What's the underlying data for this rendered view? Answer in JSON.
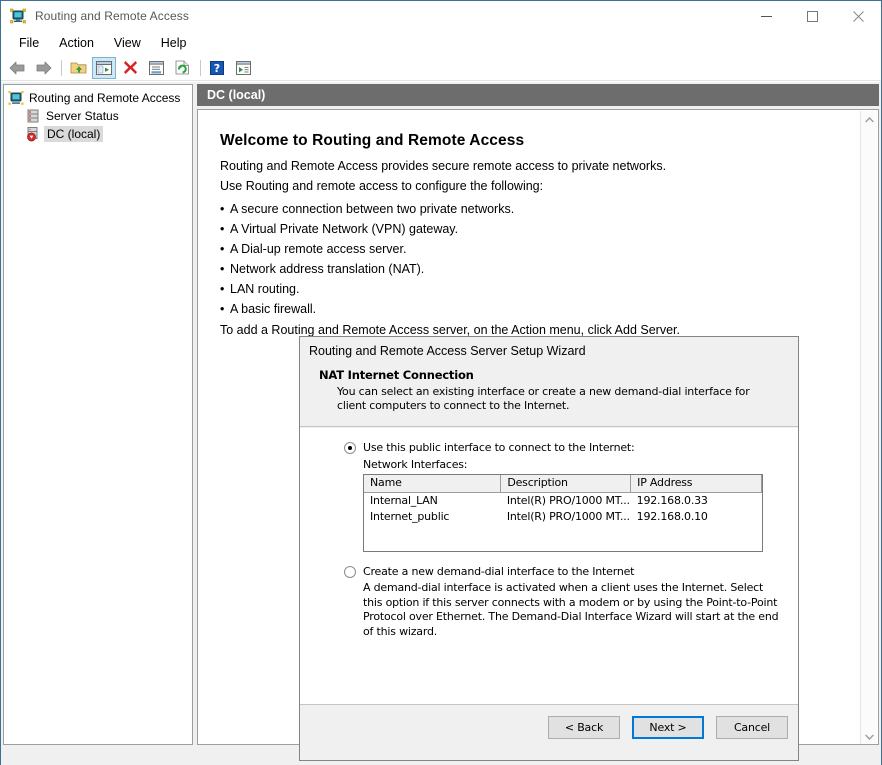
{
  "window": {
    "title": "Routing and Remote Access",
    "icon": "rras-console-icon",
    "controls": [
      {
        "name": "minimize-button",
        "glyph": "minimize"
      },
      {
        "name": "maximize-button",
        "glyph": "maximize"
      },
      {
        "name": "close-button",
        "glyph": "close"
      }
    ]
  },
  "menubar": {
    "items": [
      "File",
      "Action",
      "View",
      "Help"
    ]
  },
  "toolbar": {
    "buttons": [
      {
        "name": "back-button",
        "icon": "left-arrow-icon"
      },
      {
        "name": "forward-button",
        "icon": "right-arrow-icon"
      },
      {
        "name": "up-folder-button",
        "icon": "folder-up-icon"
      },
      {
        "name": "show-hide-console-tree-button",
        "icon": "console-tree-icon",
        "selected": true
      },
      {
        "name": "delete-button",
        "icon": "red-x-icon"
      },
      {
        "name": "properties-button",
        "icon": "properties-icon"
      },
      {
        "name": "refresh-button",
        "icon": "refresh-icon"
      },
      {
        "name": "help-button",
        "icon": "question-mark-icon"
      },
      {
        "name": "export-list-button",
        "icon": "export-list-icon"
      }
    ]
  },
  "tree": {
    "nodes": [
      {
        "label": "Routing and Remote Access",
        "icon": "rras-root-icon",
        "indent": false,
        "selected": false
      },
      {
        "label": "Server Status",
        "icon": "server-status-icon",
        "indent": true,
        "selected": false
      },
      {
        "label": "DC (local)",
        "icon": "server-local-icon",
        "indent": true,
        "selected": true
      }
    ]
  },
  "right_pane": {
    "header": "DC (local)",
    "welcome": {
      "heading": "Welcome to Routing and Remote Access",
      "intro_line_1": "Routing and Remote Access provides secure remote access to private networks.",
      "intro_line_2": "Use Routing and remote access to configure the following:",
      "bullets": [
        "A secure connection between two private networks.",
        "A Virtual Private Network (VPN) gateway.",
        "A Dial-up remote access server.",
        "Network address translation (NAT).",
        "LAN routing.",
        "A basic firewall."
      ],
      "footer_line": "To add a Routing and Remote Access server, on the Action menu, click Add Server."
    },
    "scrollbar": {
      "up_arrow": "scroll-up-icon",
      "down_arrow": "scroll-down-icon"
    }
  },
  "wizard": {
    "title": "Routing and Remote Access Server Setup Wizard",
    "page_heading": "NAT Internet Connection",
    "page_subtext": "You can select an existing interface or create a new demand-dial interface for client computers to connect to the Internet.",
    "option_public": {
      "label": "Use this public interface to connect to the Internet:",
      "selected": true
    },
    "interfaces_label": "Network Interfaces:",
    "table": {
      "columns": [
        "Name",
        "Description",
        "IP Address"
      ],
      "rows": [
        [
          "Internal_LAN",
          "Intel(R) PRO/1000 MT...",
          "192.168.0.33"
        ],
        [
          "Internet_public",
          "Intel(R) PRO/1000 MT...",
          "192.168.0.10"
        ]
      ]
    },
    "option_demand_dial": {
      "label": "Create a new demand-dial interface to the Internet",
      "selected": false,
      "description": "A demand-dial interface is activated when a client uses the Internet. Select this option if this server connects with a modem or by using the Point-to-Point Protocol over Ethernet. The Demand-Dial Interface Wizard will start at the end of this wizard."
    },
    "buttons": {
      "back": "< Back",
      "next": "Next >",
      "cancel": "Cancel"
    }
  },
  "colors": {
    "accent": "#0078d7",
    "pane_header": "#6d6d6d",
    "chrome": "#f0f0f0"
  }
}
